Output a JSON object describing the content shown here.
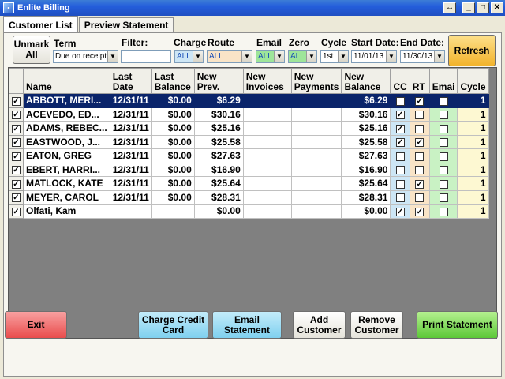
{
  "window": {
    "title": "Enlite Billing",
    "icon": "app-icon"
  },
  "tabs": [
    {
      "label": "Customer List",
      "active": true
    },
    {
      "label": "Preview Statement",
      "active": false
    }
  ],
  "toolbar": {
    "unmark_label": "Unmark All",
    "term": {
      "label": "Term",
      "value": "Due on receipt"
    },
    "filter": {
      "label": "Filter:",
      "value": ""
    },
    "charge": {
      "label": "Charge",
      "value": "ALL",
      "color": "#cde6f5"
    },
    "route": {
      "label": "Route",
      "value": "ALL",
      "color": "#f9e4c7"
    },
    "email": {
      "label": "Email",
      "value": "ALL",
      "color": "#9ee59a"
    },
    "zero": {
      "label": "Zero",
      "value": "ALL",
      "color": "#9ee59a"
    },
    "cycle": {
      "label": "Cycle",
      "value": "1st"
    },
    "start_date": {
      "label": "Start Date:",
      "value": "11/01/13"
    },
    "end_date": {
      "label": "End Date:",
      "value": "11/30/13"
    },
    "refresh_label": "Refresh"
  },
  "grid": {
    "columns": [
      "Name",
      "Last Date",
      "Last Balance",
      "New Prev.",
      "New Invoices",
      "New Payments",
      "New Balance",
      "CC",
      "RT",
      "Emai",
      "Cycle"
    ],
    "rows": [
      {
        "selected": true,
        "name": "ABBOTT, MERI...",
        "last_date": "12/31/11",
        "last_balance": "$0.00",
        "new_prev": "$6.29",
        "new_invoices": "",
        "new_payments": "",
        "new_balance": "$6.29",
        "cc": false,
        "rt": true,
        "email": false,
        "cycle": "1",
        "highlight": true
      },
      {
        "selected": true,
        "name": "ACEVEDO, ED...",
        "last_date": "12/31/11",
        "last_balance": "$0.00",
        "new_prev": "$30.16",
        "new_invoices": "",
        "new_payments": "",
        "new_balance": "$30.16",
        "cc": true,
        "rt": false,
        "email": false,
        "cycle": "1"
      },
      {
        "selected": true,
        "name": "ADAMS, REBEC...",
        "last_date": "12/31/11",
        "last_balance": "$0.00",
        "new_prev": "$25.16",
        "new_invoices": "",
        "new_payments": "",
        "new_balance": "$25.16",
        "cc": true,
        "rt": false,
        "email": false,
        "cycle": "1"
      },
      {
        "selected": true,
        "name": "EASTWOOD, J...",
        "last_date": "12/31/11",
        "last_balance": "$0.00",
        "new_prev": "$25.58",
        "new_invoices": "",
        "new_payments": "",
        "new_balance": "$25.58",
        "cc": true,
        "rt": true,
        "email": false,
        "cycle": "1"
      },
      {
        "selected": true,
        "name": "EATON, GREG",
        "last_date": "12/31/11",
        "last_balance": "$0.00",
        "new_prev": "$27.63",
        "new_invoices": "",
        "new_payments": "",
        "new_balance": "$27.63",
        "cc": false,
        "rt": false,
        "email": false,
        "cycle": "1"
      },
      {
        "selected": true,
        "name": "EBERT, HARRI...",
        "last_date": "12/31/11",
        "last_balance": "$0.00",
        "new_prev": "$16.90",
        "new_invoices": "",
        "new_payments": "",
        "new_balance": "$16.90",
        "cc": false,
        "rt": false,
        "email": false,
        "cycle": "1"
      },
      {
        "selected": true,
        "name": "MATLOCK, KATE",
        "last_date": "12/31/11",
        "last_balance": "$0.00",
        "new_prev": "$25.64",
        "new_invoices": "",
        "new_payments": "",
        "new_balance": "$25.64",
        "cc": false,
        "rt": true,
        "email": false,
        "cycle": "1"
      },
      {
        "selected": true,
        "name": "MEYER, CAROL",
        "last_date": "12/31/11",
        "last_balance": "$0.00",
        "new_prev": "$28.31",
        "new_invoices": "",
        "new_payments": "",
        "new_balance": "$28.31",
        "cc": false,
        "rt": false,
        "email": false,
        "cycle": "1"
      },
      {
        "selected": true,
        "name": "Olfati, Kam",
        "last_date": "",
        "last_balance": "",
        "new_prev": "$0.00",
        "new_invoices": "",
        "new_payments": "",
        "new_balance": "$0.00",
        "cc": true,
        "rt": true,
        "email": false,
        "cycle": "1"
      }
    ]
  },
  "bottom": {
    "exit_label": "Exit",
    "charge_cc_label": "Charge Credit Card",
    "email_statement_label": "Email Statement",
    "add_customer_label": "Add Customer",
    "remove_customer_label": "Remove Customer",
    "print_statement_label": "Print Statement"
  },
  "colors": {
    "exit": "#ee5a5a",
    "charge_cc": "#8fd6f0",
    "email_statement": "#8fd6f0",
    "print": "#6fcf4a",
    "refresh": "#f7c34a",
    "selection": "#0a246a"
  }
}
